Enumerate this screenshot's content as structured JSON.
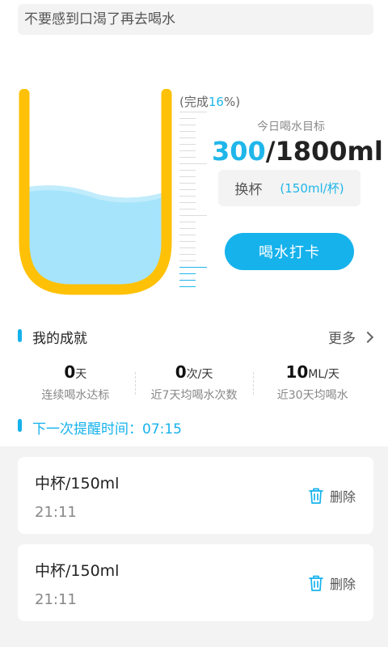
{
  "tip": {
    "text": "不要感到口渴了再去喝水"
  },
  "progress": {
    "prefix": "(完成",
    "percent": "16",
    "suffix": "%)",
    "fill_fraction": 0.16
  },
  "goal": {
    "label": "今日喝水目标",
    "current": "300",
    "total": "/1800ml"
  },
  "cup_size": {
    "label": "换杯",
    "value": "(150ml/杯)"
  },
  "checkin": {
    "label": "喝水打卡"
  },
  "achievements": {
    "title": "我的成就",
    "more": "更多",
    "stats": [
      {
        "num": "0",
        "unit": "天",
        "desc": "连续喝水达标"
      },
      {
        "num": "0",
        "unit": "次/天",
        "desc": "近7天均喝水次数"
      },
      {
        "num": "10",
        "unit": "ML/天",
        "desc": "近30天均喝水"
      }
    ]
  },
  "reminder": {
    "text": "下一次提醒时间：07:15"
  },
  "records": [
    {
      "name": "中杯/150ml",
      "time": "21:11",
      "delete": "删除"
    },
    {
      "name": "中杯/150ml",
      "time": "21:11",
      "delete": "删除"
    }
  ],
  "colors": {
    "accent": "#16b2ec",
    "cup": "#ffc107",
    "water": "#a6e4fb"
  }
}
